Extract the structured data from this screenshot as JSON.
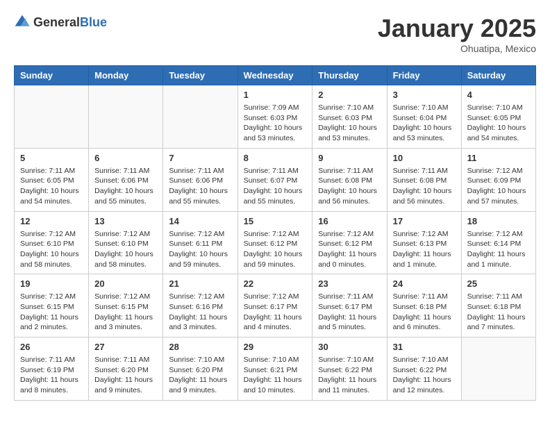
{
  "header": {
    "logo_general": "General",
    "logo_blue": "Blue",
    "month_title": "January 2025",
    "location": "Ohuatipa, Mexico"
  },
  "days_of_week": [
    "Sunday",
    "Monday",
    "Tuesday",
    "Wednesday",
    "Thursday",
    "Friday",
    "Saturday"
  ],
  "weeks": [
    [
      {
        "day": "",
        "info": ""
      },
      {
        "day": "",
        "info": ""
      },
      {
        "day": "",
        "info": ""
      },
      {
        "day": "1",
        "info": "Sunrise: 7:09 AM\nSunset: 6:03 PM\nDaylight: 10 hours\nand 53 minutes."
      },
      {
        "day": "2",
        "info": "Sunrise: 7:10 AM\nSunset: 6:03 PM\nDaylight: 10 hours\nand 53 minutes."
      },
      {
        "day": "3",
        "info": "Sunrise: 7:10 AM\nSunset: 6:04 PM\nDaylight: 10 hours\nand 53 minutes."
      },
      {
        "day": "4",
        "info": "Sunrise: 7:10 AM\nSunset: 6:05 PM\nDaylight: 10 hours\nand 54 minutes."
      }
    ],
    [
      {
        "day": "5",
        "info": "Sunrise: 7:11 AM\nSunset: 6:05 PM\nDaylight: 10 hours\nand 54 minutes."
      },
      {
        "day": "6",
        "info": "Sunrise: 7:11 AM\nSunset: 6:06 PM\nDaylight: 10 hours\nand 55 minutes."
      },
      {
        "day": "7",
        "info": "Sunrise: 7:11 AM\nSunset: 6:06 PM\nDaylight: 10 hours\nand 55 minutes."
      },
      {
        "day": "8",
        "info": "Sunrise: 7:11 AM\nSunset: 6:07 PM\nDaylight: 10 hours\nand 55 minutes."
      },
      {
        "day": "9",
        "info": "Sunrise: 7:11 AM\nSunset: 6:08 PM\nDaylight: 10 hours\nand 56 minutes."
      },
      {
        "day": "10",
        "info": "Sunrise: 7:11 AM\nSunset: 6:08 PM\nDaylight: 10 hours\nand 56 minutes."
      },
      {
        "day": "11",
        "info": "Sunrise: 7:12 AM\nSunset: 6:09 PM\nDaylight: 10 hours\nand 57 minutes."
      }
    ],
    [
      {
        "day": "12",
        "info": "Sunrise: 7:12 AM\nSunset: 6:10 PM\nDaylight: 10 hours\nand 58 minutes."
      },
      {
        "day": "13",
        "info": "Sunrise: 7:12 AM\nSunset: 6:10 PM\nDaylight: 10 hours\nand 58 minutes."
      },
      {
        "day": "14",
        "info": "Sunrise: 7:12 AM\nSunset: 6:11 PM\nDaylight: 10 hours\nand 59 minutes."
      },
      {
        "day": "15",
        "info": "Sunrise: 7:12 AM\nSunset: 6:12 PM\nDaylight: 10 hours\nand 59 minutes."
      },
      {
        "day": "16",
        "info": "Sunrise: 7:12 AM\nSunset: 6:12 PM\nDaylight: 11 hours\nand 0 minutes."
      },
      {
        "day": "17",
        "info": "Sunrise: 7:12 AM\nSunset: 6:13 PM\nDaylight: 11 hours\nand 1 minute."
      },
      {
        "day": "18",
        "info": "Sunrise: 7:12 AM\nSunset: 6:14 PM\nDaylight: 11 hours\nand 1 minute."
      }
    ],
    [
      {
        "day": "19",
        "info": "Sunrise: 7:12 AM\nSunset: 6:15 PM\nDaylight: 11 hours\nand 2 minutes."
      },
      {
        "day": "20",
        "info": "Sunrise: 7:12 AM\nSunset: 6:15 PM\nDaylight: 11 hours\nand 3 minutes."
      },
      {
        "day": "21",
        "info": "Sunrise: 7:12 AM\nSunset: 6:16 PM\nDaylight: 11 hours\nand 3 minutes."
      },
      {
        "day": "22",
        "info": "Sunrise: 7:12 AM\nSunset: 6:17 PM\nDaylight: 11 hours\nand 4 minutes."
      },
      {
        "day": "23",
        "info": "Sunrise: 7:11 AM\nSunset: 6:17 PM\nDaylight: 11 hours\nand 5 minutes."
      },
      {
        "day": "24",
        "info": "Sunrise: 7:11 AM\nSunset: 6:18 PM\nDaylight: 11 hours\nand 6 minutes."
      },
      {
        "day": "25",
        "info": "Sunrise: 7:11 AM\nSunset: 6:18 PM\nDaylight: 11 hours\nand 7 minutes."
      }
    ],
    [
      {
        "day": "26",
        "info": "Sunrise: 7:11 AM\nSunset: 6:19 PM\nDaylight: 11 hours\nand 8 minutes."
      },
      {
        "day": "27",
        "info": "Sunrise: 7:11 AM\nSunset: 6:20 PM\nDaylight: 11 hours\nand 9 minutes."
      },
      {
        "day": "28",
        "info": "Sunrise: 7:10 AM\nSunset: 6:20 PM\nDaylight: 11 hours\nand 9 minutes."
      },
      {
        "day": "29",
        "info": "Sunrise: 7:10 AM\nSunset: 6:21 PM\nDaylight: 11 hours\nand 10 minutes."
      },
      {
        "day": "30",
        "info": "Sunrise: 7:10 AM\nSunset: 6:22 PM\nDaylight: 11 hours\nand 11 minutes."
      },
      {
        "day": "31",
        "info": "Sunrise: 7:10 AM\nSunset: 6:22 PM\nDaylight: 11 hours\nand 12 minutes."
      },
      {
        "day": "",
        "info": ""
      }
    ]
  ]
}
